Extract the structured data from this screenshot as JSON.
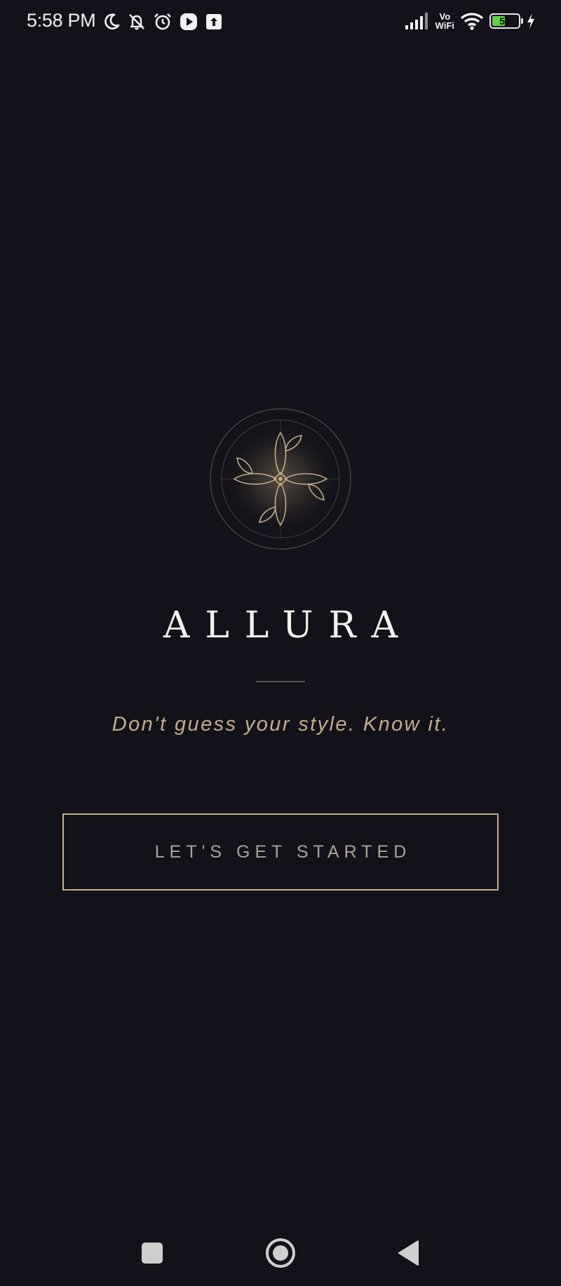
{
  "status_bar": {
    "time": "5:58 PM",
    "left_icons": [
      "moon-icon",
      "bell-off-icon",
      "alarm-icon",
      "play-icon",
      "upload-icon"
    ],
    "right_icons": [
      "signal-icon",
      "vowifi-icon",
      "wifi-icon",
      "battery-icon",
      "charging-icon"
    ],
    "vowifi_top": "Vo",
    "vowifi_bottom": "WiFi",
    "battery_level": "55",
    "battery_fraction": 0.55,
    "battery_color": "#5fd24a"
  },
  "splash": {
    "logo_icon": "floral-emblem-icon",
    "brand_name": "ALLURA",
    "tagline": "Don't guess your style. Know it.",
    "cta_label": "LET'S GET STARTED"
  },
  "colors": {
    "background": "#13121a",
    "accent_gold": "#c4ad8c",
    "title": "#f4f1ec",
    "button_text": "#a9a39a"
  },
  "nav_bar": {
    "buttons": [
      "recents-icon",
      "home-icon",
      "back-icon"
    ]
  }
}
